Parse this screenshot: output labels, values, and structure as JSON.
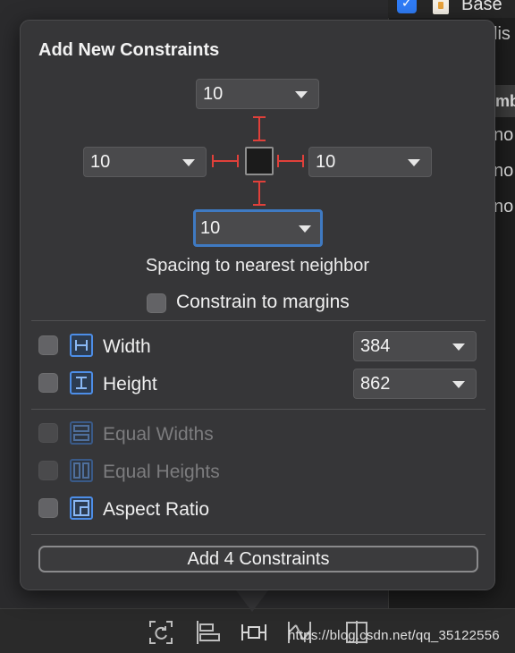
{
  "background": {
    "base_label": "Base",
    "partial_text": "lis",
    "column_header": "mb",
    "cells": [
      "no",
      "no",
      "no"
    ]
  },
  "popover": {
    "title": "Add New Constraints",
    "spacing": {
      "top": "10",
      "left": "10",
      "right": "10",
      "bottom": "10",
      "caption": "Spacing to nearest neighbor"
    },
    "constrain_to_margins": "Constrain to margins",
    "width": {
      "label": "Width",
      "value": "384"
    },
    "height": {
      "label": "Height",
      "value": "862"
    },
    "equal_widths": "Equal Widths",
    "equal_heights": "Equal Heights",
    "aspect_ratio": "Aspect Ratio",
    "add_button": "Add 4 Constraints"
  },
  "watermark": "https://blog.csdn.net/qq_35122556",
  "colors": {
    "accent": "#4d8ee8",
    "strut": "#e0403a",
    "focus": "#3f7ac2"
  }
}
